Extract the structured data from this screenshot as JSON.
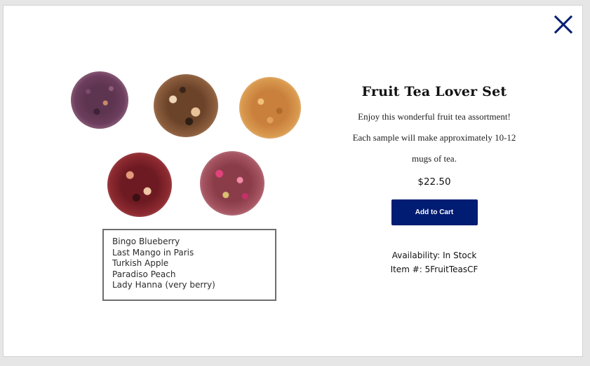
{
  "modal": {
    "close_icon": "close-icon",
    "accent_color": "#001c73"
  },
  "product": {
    "title": "Fruit Tea Lover Set",
    "description_lines": [
      "Enjoy this wonderful fruit tea assortment!",
      "Each sample will make approximately 10-12",
      "mugs of tea."
    ],
    "price": "$22.50",
    "add_to_cart_label": "Add to Cart",
    "availability": "Availability: In Stock",
    "item_number": "Item #: 5FruitTeasCF"
  },
  "image": {
    "flavors": [
      "Bingo Blueberry",
      "Last Mango in Paris",
      "Turkish Apple",
      "Paradiso Peach",
      "Lady Hanna (very berry)"
    ]
  }
}
